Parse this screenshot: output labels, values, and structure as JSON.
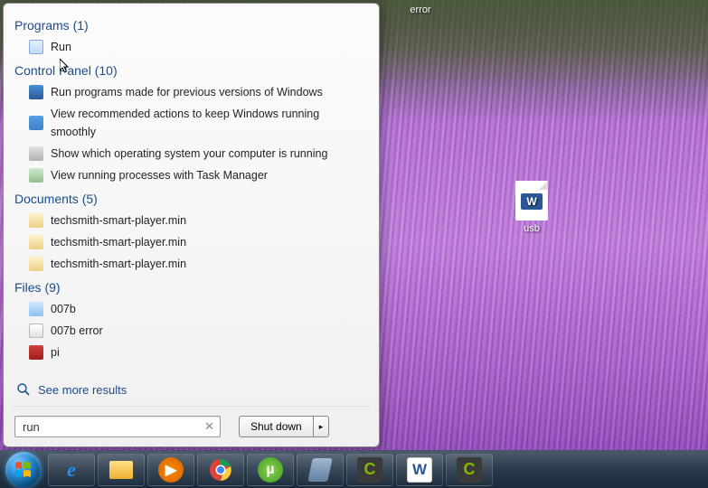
{
  "desktop": {
    "error_label": "error",
    "usb_label": "usb"
  },
  "start_menu": {
    "search_value": "run",
    "more_results": "See more results",
    "shutdown_label": "Shut down",
    "sections": {
      "programs": {
        "header": "Programs (1)",
        "items": [
          "Run"
        ]
      },
      "control_panel": {
        "header": "Control Panel (10)",
        "items": [
          "Run programs made for previous versions of Windows",
          "View recommended actions to keep Windows running smoothly",
          "Show which operating system your computer is running",
          "View running processes with Task Manager"
        ]
      },
      "documents": {
        "header": "Documents (5)",
        "items": [
          "techsmith-smart-player.min",
          "techsmith-smart-player.min",
          "techsmith-smart-player.min"
        ]
      },
      "files": {
        "header": "Files (9)",
        "items": [
          "007b",
          "007b error",
          "pi"
        ]
      }
    }
  },
  "taskbar": {
    "apps": [
      "ie",
      "explorer",
      "media-player",
      "chrome",
      "utorrent",
      "notepad-app",
      "camtasia",
      "word",
      "camtasia-editor"
    ]
  }
}
